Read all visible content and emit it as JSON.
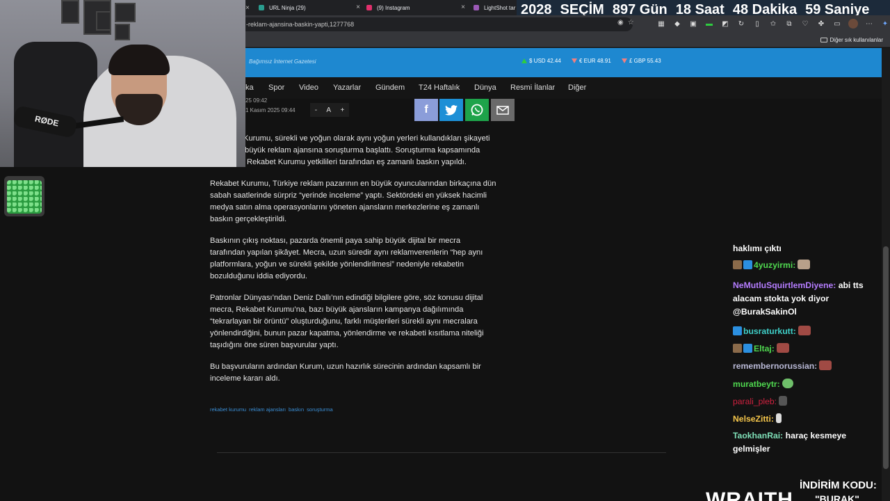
{
  "browser": {
    "tabs": [
      {
        "label": "URL Ninja (29)",
        "favicon_color": "#2a9d8f"
      },
      {
        "label": "(9) Instagram",
        "favicon_color": "#e1306c"
      },
      {
        "label": "LightShot tar",
        "favicon_color": "#9b59b6"
      }
    ],
    "url": "-reklam-ajansina-baskin-yapti,1277768",
    "bookmarks_other": "Diğer sık kullanılanlar"
  },
  "countdown": {
    "year": "2028",
    "label": "SEÇİM",
    "days": "897 Gün",
    "hours": "18 Saat",
    "minutes": "48 Dakika",
    "seconds": "59 Saniye"
  },
  "site": {
    "tagline": "Bağımsız İnternet Gazetesi",
    "currencies": [
      {
        "label": "$ USD 42.44",
        "trend": "up"
      },
      {
        "label": "€ EUR 48.91",
        "trend": "down"
      },
      {
        "label": "£ GBP 55.43",
        "trend": "down"
      }
    ],
    "nav": [
      "ka",
      "Spor",
      "Video",
      "Yazarlar",
      "Gündem",
      "T24 Haftalık",
      "Dünya",
      "Resmi İlanlar",
      "Diğer"
    ]
  },
  "article": {
    "meta_updated": "25 09:42",
    "meta_date": "1 Kasım 2025 09:44",
    "font_controls": [
      "-",
      "A",
      "+"
    ],
    "share_icons": [
      "facebook-icon",
      "twitter-icon",
      "whatsapp-icon",
      "mail-icon"
    ],
    "share_colors": [
      "#8b9dd9",
      "#1d8fd6",
      "#1ea34a",
      "#6a6a6a"
    ],
    "paragraphs": [
      [
        "Kurumu, sürekli ve yoğun olarak aynı yoğun yerleri kullandıkları şikayeti",
        "büyük reklam ajansına soruşturma başlattı. Soruşturma kapsamında",
        "Rekabet Kurumu yetkilileri tarafından eş zamanlı baskın yapıldı."
      ],
      [
        "Rekabet Kurumu, Türkiye reklam pazarının en büyük oyuncularından birkaçına dün",
        "sabah saatlerinde sürpriz “yerinde inceleme” yaptı. Sektördeki en yüksek hacimli",
        "medya satın alma operasyonlarını yöneten ajansların merkezlerine eş zamanlı",
        "baskın gerçekleştirildi."
      ],
      [
        "Baskının çıkış noktası, pazarda önemli paya sahip büyük dijital bir mecra",
        "tarafından yapılan şikâyet. Mecra, uzun süredir aynı reklamverenlerin “hep aynı",
        "platformlara, yoğun ve sürekli şekilde yönlendirilmesi” nedeniyle rekabetin",
        "bozulduğunu iddia ediyordu."
      ],
      [
        "Patronlar Dünyası’ndan Deniz Dallı’nın edindiği bilgilere göre, söz konusu dijital",
        "mecra, Rekabet Kurumu’na, bazı büyük ajansların kampanya dağılımında",
        "“tekrarlayan bir örüntü” oluşturduğunu, farklı müşterileri sürekli aynı mecralara",
        "yönlendirdiğini, bunun pazar kapatma, yönlendirme ve rekabeti kısıtlama niteliği",
        "taşıdığını öne süren başvurular yaptı."
      ],
      [
        "Bu başvuruların ardından Kurum, uzun hazırlık sürecinin ardından kapsamlı bir",
        "inceleme kararı aldı."
      ]
    ],
    "tags": [
      "rekabet kurumu",
      "reklam ajansları",
      "baskın",
      "soruşturma"
    ]
  },
  "chat": {
    "messages": [
      {
        "user": "",
        "text": "haklımı çıktı",
        "color": "#ffffff"
      },
      {
        "user": "4yuzyirmi:",
        "text": "",
        "color": "#4fd84f"
      },
      {
        "user": "NeMutluSquirtlemDiyene:",
        "text": "abi tts alacam stokta yok diyor @BurakSakinOl",
        "color": "#b57dff"
      },
      {
        "user": "busraturkutt:",
        "text": "",
        "color": "#3fd0c9"
      },
      {
        "user": "Eltaj:",
        "text": "",
        "color": "#4fd84f"
      },
      {
        "user": "remembernorussian:",
        "text": "",
        "color": "#b9b9d6"
      },
      {
        "user": "muratbeytr:",
        "text": "",
        "color": "#4fd84f"
      },
      {
        "user": "parali_pleb:",
        "text": "",
        "color": "#d0213f"
      },
      {
        "user": "NelseZitti:",
        "text": "",
        "color": "#f5c64b"
      },
      {
        "user": "TaokhanRai:",
        "text": "haraç kesmeye gelmişler",
        "color": "#7fe0b8"
      }
    ]
  },
  "promo": {
    "code_label": "İNDİRİM KODU:",
    "code_value": "\"BURAK\"",
    "brand": "WRAITH"
  }
}
